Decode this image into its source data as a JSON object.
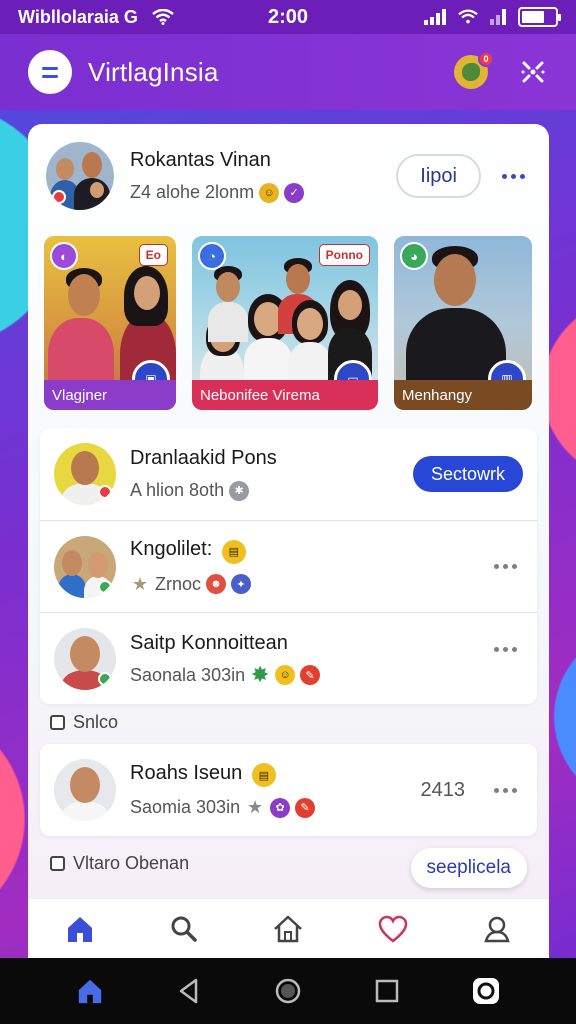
{
  "status_bar": {
    "carrier": "Wibllolaraia G",
    "time": "2:00"
  },
  "app_bar": {
    "title": "VirtlagInsia",
    "notification_count": "0"
  },
  "profile": {
    "name": "Rokantas Vinan",
    "subtitle": "Z4 alohe 2lonm",
    "follow_label": "Iipoi"
  },
  "stories": [
    {
      "caption": "Vlagjner",
      "chip": "Eo"
    },
    {
      "caption": "Nebonifee Virema",
      "chip": "Ponno"
    },
    {
      "caption": "Menhangy",
      "chip": ""
    }
  ],
  "list_top": [
    {
      "name": "Dranlaakid Pons",
      "subtitle": "A hlion 8oth",
      "action_label": "Sectowrk"
    },
    {
      "name": "Kngolilet:",
      "subtitle": "Zrnoc"
    },
    {
      "name": "Saitp Konnoittean",
      "subtitle": "Saonala 303in"
    }
  ],
  "section_one": {
    "label": "Snlco"
  },
  "list_bottom": [
    {
      "name": "Roahs Iseun",
      "subtitle": "Saomia 303in",
      "value": "2413"
    }
  ],
  "section_two": {
    "label": "Vltaro Obenan",
    "button_label": "seeplicela"
  },
  "colors": {
    "accent": "#2847d6",
    "appbar": "#7a2fd0",
    "statusbar": "#6b1fb8"
  },
  "icons": {
    "menu": "menu-icon",
    "settings": "sparkle-icon",
    "nav": [
      "home-icon",
      "search-icon",
      "house-icon",
      "heart-icon",
      "profile-icon"
    ],
    "system": [
      "home-icon",
      "back-icon",
      "circle-home-icon",
      "recents-icon",
      "record-icon"
    ]
  }
}
